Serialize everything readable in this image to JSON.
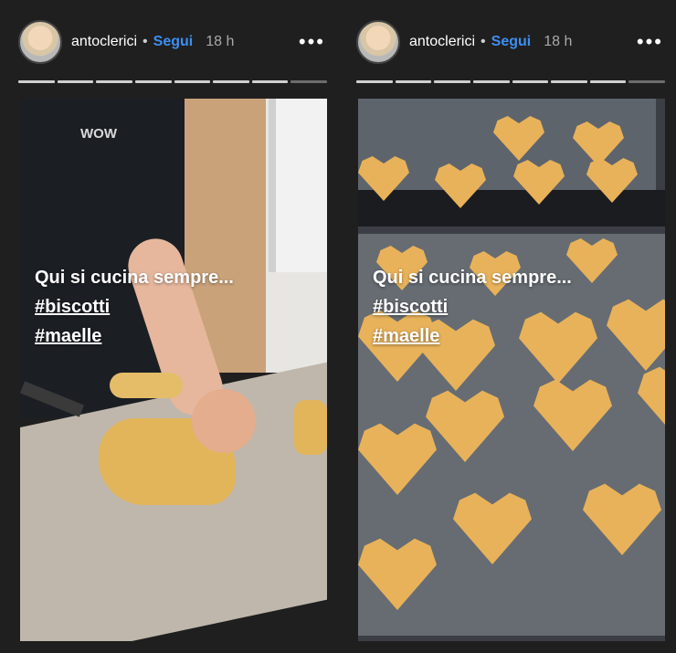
{
  "stories": [
    {
      "username": "antoclerici",
      "separator": "•",
      "follow_label": "Segui",
      "time_ago": "18 h",
      "more_label": "•••",
      "caption": {
        "line1": "Qui si cucina sempre...",
        "hashtag1": "#biscotti",
        "hashtag2": "#maelle"
      },
      "shirt_logo": "WOW"
    },
    {
      "username": "antoclerici",
      "separator": "•",
      "follow_label": "Segui",
      "time_ago": "18 h",
      "more_label": "•••",
      "caption": {
        "line1": "Qui si cucina sempre...",
        "hashtag1": "#biscotti",
        "hashtag2": "#maelle"
      }
    }
  ],
  "colors": {
    "background": "#1f1f1f",
    "follow": "#3d8ef0"
  },
  "icons": {
    "more": "more-options-icon"
  }
}
